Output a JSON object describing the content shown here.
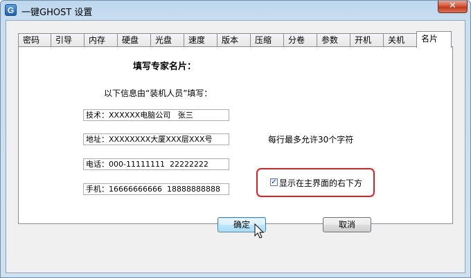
{
  "window": {
    "title": "一键GHOST 设置",
    "app_icon_letter": "G",
    "close_symbol": "✕"
  },
  "tabs": [
    {
      "label": "密码"
    },
    {
      "label": "引导"
    },
    {
      "label": "内存"
    },
    {
      "label": "硬盘"
    },
    {
      "label": "光盘"
    },
    {
      "label": "速度"
    },
    {
      "label": "版本"
    },
    {
      "label": "压缩"
    },
    {
      "label": "分卷"
    },
    {
      "label": "参数"
    },
    {
      "label": "开机"
    },
    {
      "label": "关机"
    },
    {
      "label": "名片",
      "active": true
    }
  ],
  "panel": {
    "heading": "填写专家名片：",
    "intro": "以下信息由“装机人员”填写：",
    "fields": {
      "tech": "技术：XXXXXX电脑公司   张三",
      "address": "地址：XXXXXXXX大厦XXX层XXX号",
      "phone": "电话：000-11111111  22222222",
      "mobile": "手机：16666666666  18888888888"
    },
    "limit_note": "每行最多允许30个字符",
    "show_checkbox": {
      "label": "显示在主界面的右下方",
      "checked": true,
      "check_mark": "✓"
    }
  },
  "buttons": {
    "ok": "确定",
    "cancel": "取消"
  },
  "colors": {
    "highlight_border": "#e02020",
    "titlebar": "#bcd7ee",
    "close_button": "#c2381c"
  }
}
